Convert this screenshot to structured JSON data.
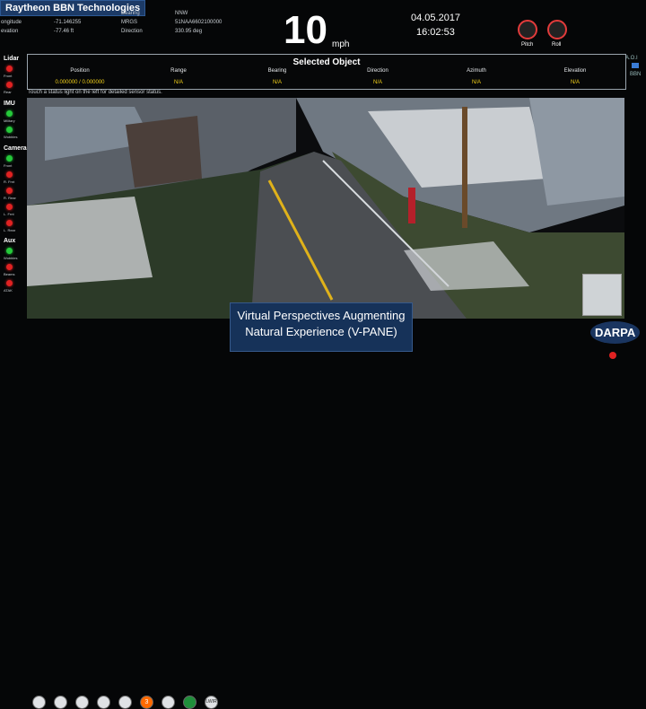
{
  "brand": "Raytheon BBN Technologies",
  "telemetry": {
    "longitude_label": "ongitude",
    "longitude_value": "-71.146255",
    "elevation_label": "evation",
    "elevation_value": "-77.46 ft",
    "bearing_label": "Bearing",
    "bearing_value": "NNW",
    "mgrs_label": "MRGS",
    "mgrs_value": "51NAA6602100000",
    "direction_label": "Direction",
    "direction_value": "330.95 deg"
  },
  "speed": {
    "value": "10",
    "unit": "mph"
  },
  "datetime": {
    "date": "04.05.2017",
    "time": "16:02:53"
  },
  "gauges": [
    {
      "label": "Pitch"
    },
    {
      "label": "Roll"
    }
  ],
  "aoi": {
    "label": "A.O.I",
    "sub": "BBN"
  },
  "selected_object": {
    "title": "Selected Object",
    "columns": [
      "Position",
      "Range",
      "Bearing",
      "Direction",
      "Azimuth",
      "Elevation"
    ],
    "values": [
      "0.000000 / 0.000000",
      "N/A",
      "N/A",
      "N/A",
      "N/A",
      "N/A"
    ]
  },
  "hint": "Touch a status light on the left for detailed sensor status.",
  "sidebar": {
    "lidar": {
      "title": "Lidar",
      "items": [
        {
          "label": "Front",
          "status": "red"
        },
        {
          "label": "Rear",
          "status": "red"
        }
      ]
    },
    "imu": {
      "title": "IMU",
      "items": [
        {
          "label": "Military",
          "status": "green"
        },
        {
          "label": "Wobbles",
          "status": "green"
        }
      ]
    },
    "cameras": {
      "title": "Cameras",
      "items": [
        {
          "label": "Front",
          "status": "green"
        },
        {
          "label": "R. Frnt",
          "status": "red"
        },
        {
          "label": "R. Rear",
          "status": "red"
        },
        {
          "label": "L. Frnt",
          "status": "red"
        },
        {
          "label": "L. Rear",
          "status": "red"
        }
      ]
    },
    "aux": {
      "title": "Aux",
      "items": [
        {
          "label": "Wobbles",
          "status": "green"
        },
        {
          "label": "Beams",
          "status": "red"
        },
        {
          "label": "ATAK",
          "status": "red"
        }
      ]
    }
  },
  "caption": {
    "line1": "Virtual Perspectives Augmenting",
    "line2": "Natural Experience (V-PANE)"
  },
  "darpa": "DARPA",
  "toolbar": {
    "count": 9,
    "labels": [
      "",
      "",
      "",
      "",
      "",
      "3",
      "",
      "",
      "LWIR"
    ]
  },
  "colors": {
    "accent_yellow": "#f4d21a",
    "status_green": "#25c93a",
    "status_red": "#e02222",
    "brand_blue": "#1c3a66"
  }
}
